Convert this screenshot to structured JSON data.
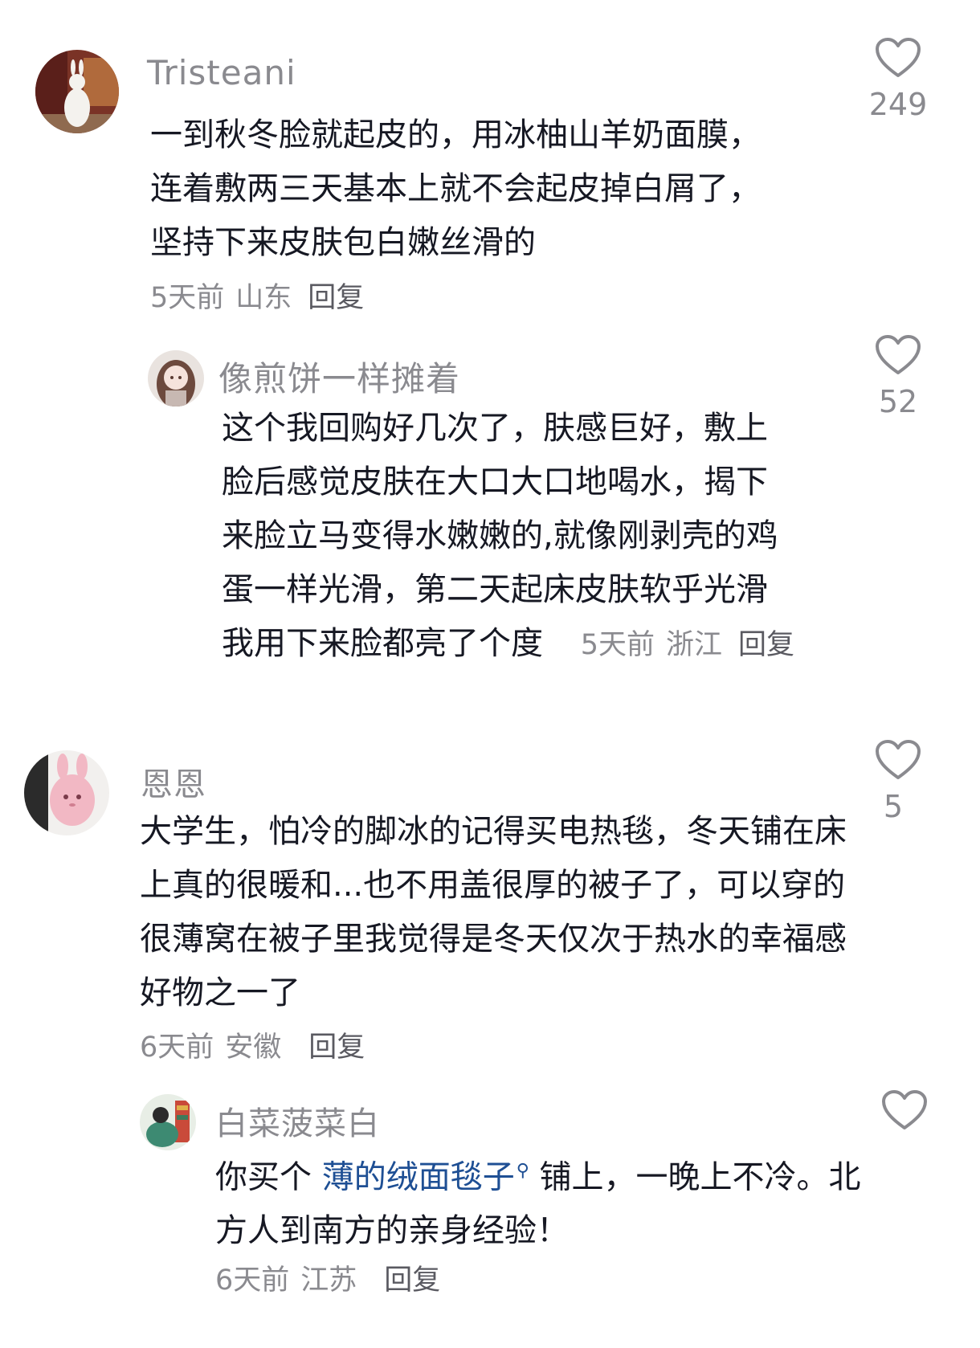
{
  "comments": [
    {
      "username": "Tristeani",
      "lines": [
        "一到秋冬脸就起皮的，用冰柚山羊奶面膜，",
        "连着敷两三天基本上就不会起皮掉白屑了，",
        "坚持下来皮肤包白嫩丝滑的"
      ],
      "time": "5天前",
      "location": "山东",
      "reply_label": "回复",
      "likes": "249",
      "avatar_icon": "bunny-figure-avatar"
    },
    {
      "username": "像煎饼一样摊着",
      "lines": [
        "这个我回购好几次了，肤感巨好，敷上",
        "脸后感觉皮肤在大口大口地喝水，揭下",
        "来脸立马变得水嫩嫩的,就像刚剥壳的鸡",
        "蛋一样光滑，第二天起床皮肤软乎光滑",
        "我用下来脸都亮了个度"
      ],
      "time": "5天前",
      "location": "浙江",
      "reply_label": "回复",
      "likes": "52",
      "avatar_icon": "anime-girl-avatar"
    },
    {
      "username": "恩恩",
      "lines": [
        "大学生，怕冷的脚冰的记得买电热毯，冬天铺在床",
        "上真的很暖和...也不用盖很厚的被子了，可以穿的",
        "很薄窝在被子里我觉得是冬天仅次于热水的幸福感",
        "好物之一了"
      ],
      "time": "6天前",
      "location": "安徽",
      "reply_label": "回复",
      "likes": "5",
      "avatar_icon": "pink-bunny-plush-avatar"
    },
    {
      "username": "白菜菠菜白",
      "line1_before": "你买个 ",
      "line1_link": "薄的绒面毯子",
      "line1_after": " 铺上，一晚上不冷。北",
      "line2": "方人到南方的亲身经验！",
      "time": "6天前",
      "location": "江苏",
      "reply_label": "回复",
      "likes": "",
      "avatar_icon": "girl-reading-avatar"
    }
  ],
  "colors": {
    "text": "#161823",
    "secondary": "#8a8a8f",
    "link": "#1e4f94",
    "heart_stroke": "#8a8a8f"
  },
  "icons": {
    "like": "heart-outline-icon",
    "search": "search-icon"
  }
}
